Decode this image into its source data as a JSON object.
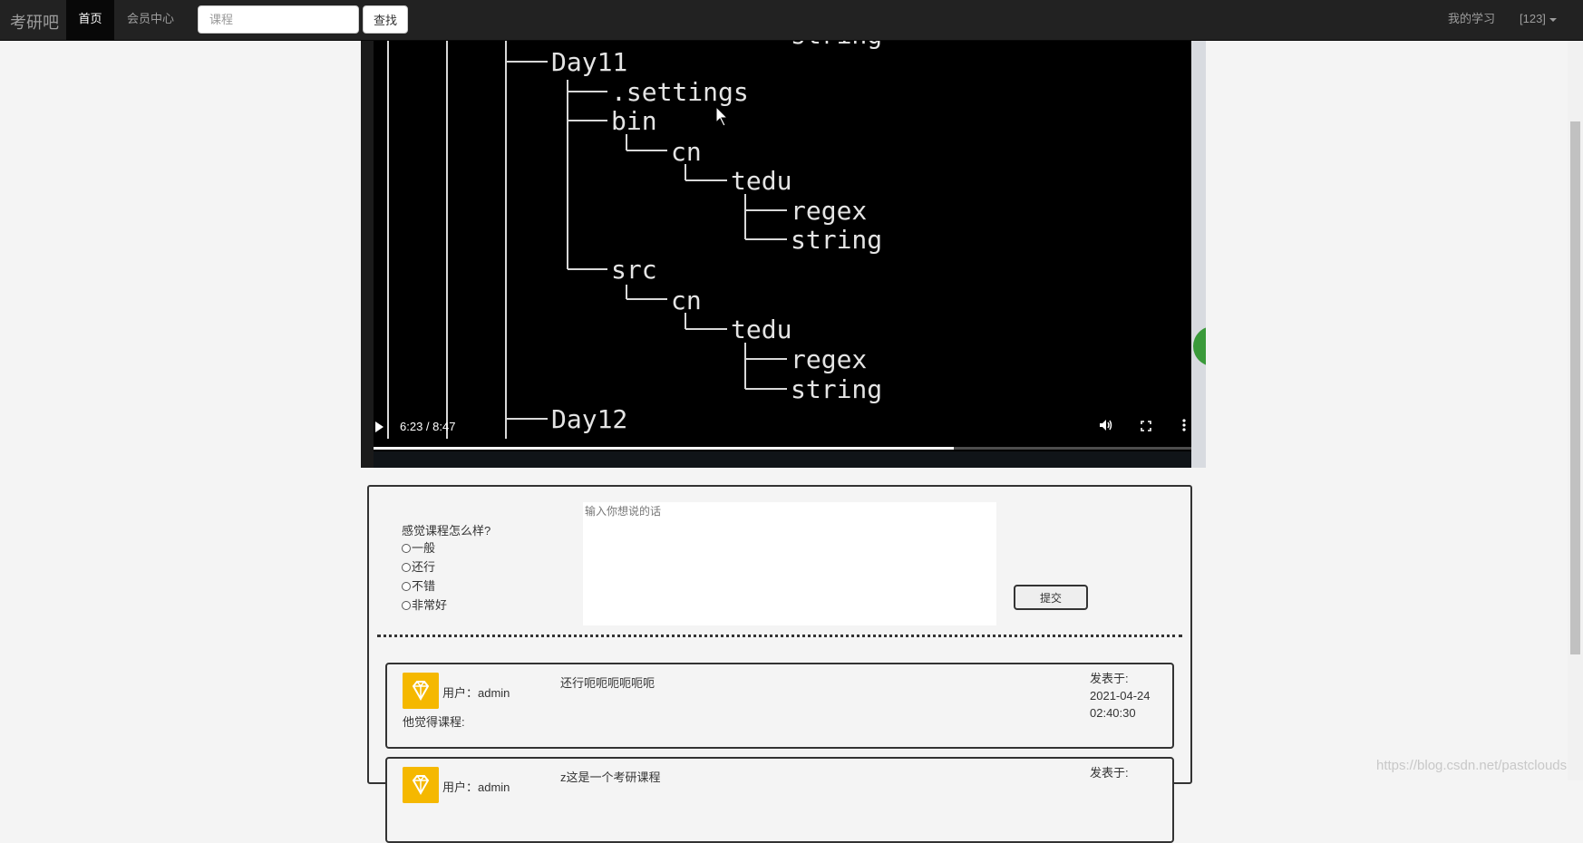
{
  "navbar": {
    "brand": "考研吧",
    "home": "首页",
    "member_center": "会员中心",
    "search_placeholder": "课程",
    "search_button": "查找",
    "my_study": "我的学习",
    "user": "[123]"
  },
  "video": {
    "time": "6:23 / 8:47",
    "progress": 0.71,
    "content_lines": [
      "string",
      "Day11",
      ".settings",
      "bin",
      "cn",
      "tedu",
      "regex",
      "string",
      "src",
      "cn",
      "tedu",
      "regex",
      "string",
      "Day12"
    ]
  },
  "comment_form": {
    "rating_question": "感觉课程怎么样?",
    "options": [
      "一般",
      "还行",
      "不错",
      "非常好"
    ],
    "textarea_placeholder": "输入你想说的话",
    "submit": "提交"
  },
  "comments": [
    {
      "user": "用户：admin",
      "rating_label": "他觉得课程:",
      "text": "还行呃呃呃呃呃呃",
      "posted_label": "发表于:",
      "date": "2021-04-24",
      "time": "02:40:30"
    },
    {
      "user": "用户：admin",
      "text": "z这是一个考研课程",
      "posted_label": "发表于:"
    }
  ],
  "watermark": "https://blog.csdn.net/pastclouds"
}
